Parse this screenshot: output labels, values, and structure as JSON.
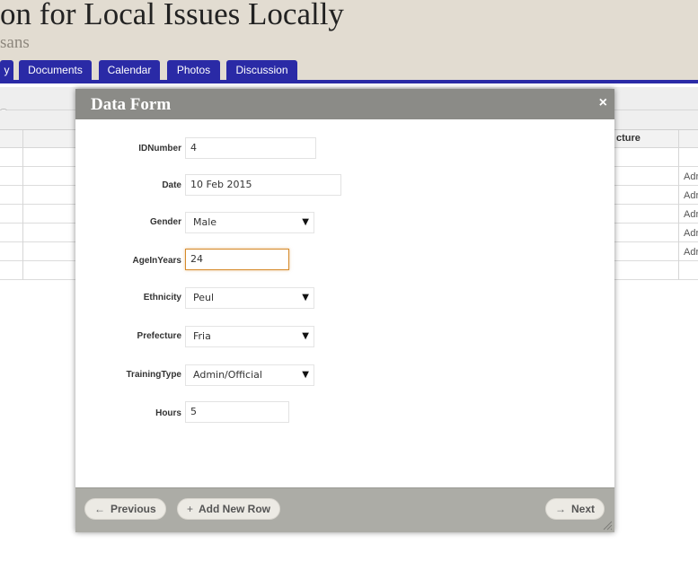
{
  "site": {
    "title": "on for Local Issues Locally",
    "subtitle": "sans"
  },
  "tabs": [
    {
      "label": "y"
    },
    {
      "label": "Documents"
    },
    {
      "label": "Calendar"
    },
    {
      "label": "Photos"
    },
    {
      "label": "Discussion"
    }
  ],
  "grid": {
    "column_header": "cture",
    "row_cells": [
      "Adr",
      "Adr",
      "Adr",
      "Adr",
      "Adr"
    ]
  },
  "modal": {
    "title": "Data Form",
    "close_glyph": "×",
    "fields": {
      "idnumber": {
        "label": "IDNumber",
        "value": "4"
      },
      "date": {
        "label": "Date",
        "value": "10 Feb 2015"
      },
      "gender": {
        "label": "Gender",
        "value": "Male"
      },
      "age": {
        "label": "AgeInYears",
        "value": "24"
      },
      "ethnicity": {
        "label": "Ethnicity",
        "value": "Peul"
      },
      "prefecture": {
        "label": "Prefecture",
        "value": "Fria"
      },
      "training_type": {
        "label": "TrainingType",
        "value": "Admin/Official"
      },
      "hours": {
        "label": "Hours",
        "value": "5"
      }
    },
    "select_arrow": "▼",
    "footer": {
      "previous": {
        "glyph": "←",
        "label": "Previous"
      },
      "add_row": {
        "glyph": "+",
        "label": "Add New Row"
      },
      "next": {
        "glyph": "→",
        "label": "Next"
      }
    }
  },
  "colors": {
    "header_bg": "#e2dcd1",
    "tab_blue": "#2a2aa6",
    "modal_title_bar": "#8b8b87",
    "modal_footer": "#acaca6",
    "focus_border": "#d68a2a"
  }
}
